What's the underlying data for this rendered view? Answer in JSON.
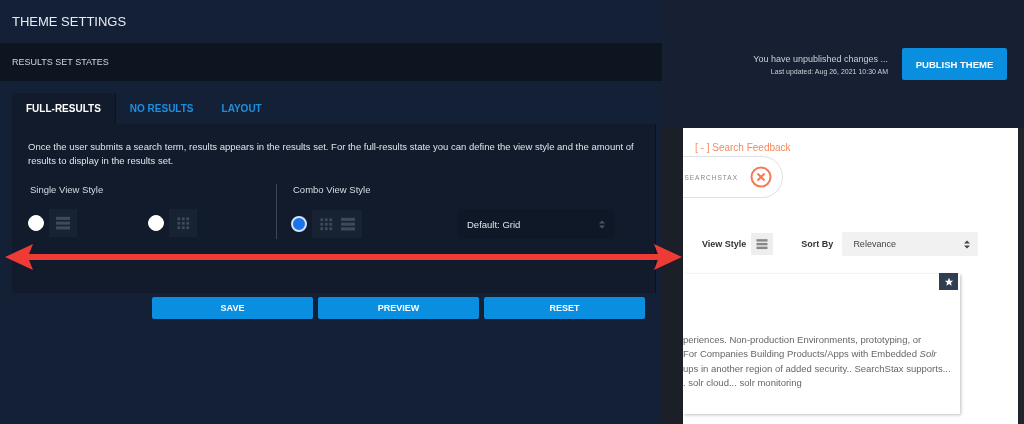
{
  "panel": {
    "title": "THEME SETTINGS",
    "section": "RESULTS SET STATES",
    "tabs": [
      {
        "label": "FULL-RESULTS",
        "selected": true
      },
      {
        "label": "NO RESULTS",
        "selected": false
      },
      {
        "label": "LAYOUT",
        "selected": false
      }
    ],
    "description": "Once the user submits a search term, results appears in the results set. For the full-results state you can define the view style and the amount of results to display in the results set.",
    "groups": [
      {
        "label": "Single View Style",
        "options": [
          {
            "kind": "list",
            "selected": false
          },
          {
            "kind": "grid",
            "selected": false
          }
        ]
      },
      {
        "label": "Combo View Style",
        "options": [
          {
            "kind": "combo",
            "selected": true
          }
        ],
        "select": {
          "value": "Default: Grid"
        }
      }
    ],
    "buttons": [
      "SAVE",
      "PREVIEW",
      "RESET"
    ]
  },
  "header": {
    "status": "You have unpublished changes ...",
    "updated": "Last updated: Aug 26, 2021 10:30 AM",
    "button": "PUBLISH THEME"
  },
  "preview": {
    "feedback": "[ - ] Search Feedback",
    "logo": "SEARCHSTAX",
    "view_style_label": "View Style",
    "sort_label": "Sort By",
    "sort_value": "Relevance",
    "result_lines": [
      "periences. Non-production Environments, prototyping, or",
      "For Companies Building Products/Apps with Embedded *Solr*",
      "ups in another region of added security.. SearchStax supports...",
      ". solr cloud... solr monitoring"
    ]
  }
}
